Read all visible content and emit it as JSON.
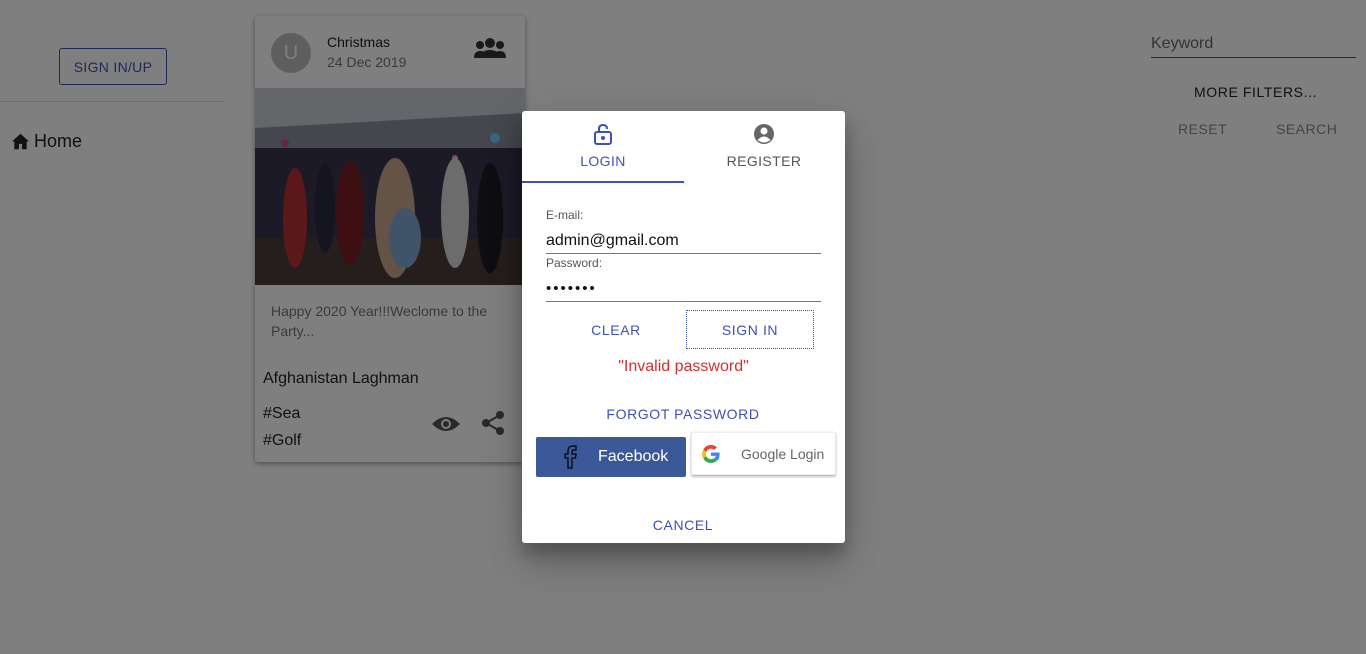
{
  "nav": {
    "signin_label": "SIGN IN/UP",
    "home_label": "Home"
  },
  "card": {
    "avatar_letter": "U",
    "title": "Christmas",
    "date": "24 Dec 2019",
    "description": "Happy 2020 Year!!!Weclome to the Party...",
    "location": "Afghanistan Laghman",
    "tags": [
      "#Sea",
      "#Golf"
    ]
  },
  "filters": {
    "keyword_placeholder": "Keyword",
    "more_filters_label": "MORE FILTERS...",
    "reset_label": "RESET",
    "search_label": "SEARCH"
  },
  "dialog": {
    "tabs": [
      {
        "label": "LOGIN",
        "icon": "lock-open-icon",
        "active": true
      },
      {
        "label": "REGISTER",
        "icon": "account-circle-icon",
        "active": false
      }
    ],
    "email_label": "E-mail:",
    "email_value": "admin@gmail.com",
    "password_label": "Password:",
    "password_value": "1234567",
    "clear_label": "CLEAR",
    "signin_label": "SIGN IN",
    "error_message": "\"Invalid password\"",
    "forgot_label": "FORGOT PASSWORD",
    "facebook_label": "Facebook",
    "google_label": "Google Login",
    "cancel_label": "CANCEL"
  },
  "colors": {
    "primary": "#3f51b5",
    "error": "#d32f2f",
    "facebook": "#3b5998",
    "backdrop": "rgba(0,0,0,0.5)"
  }
}
